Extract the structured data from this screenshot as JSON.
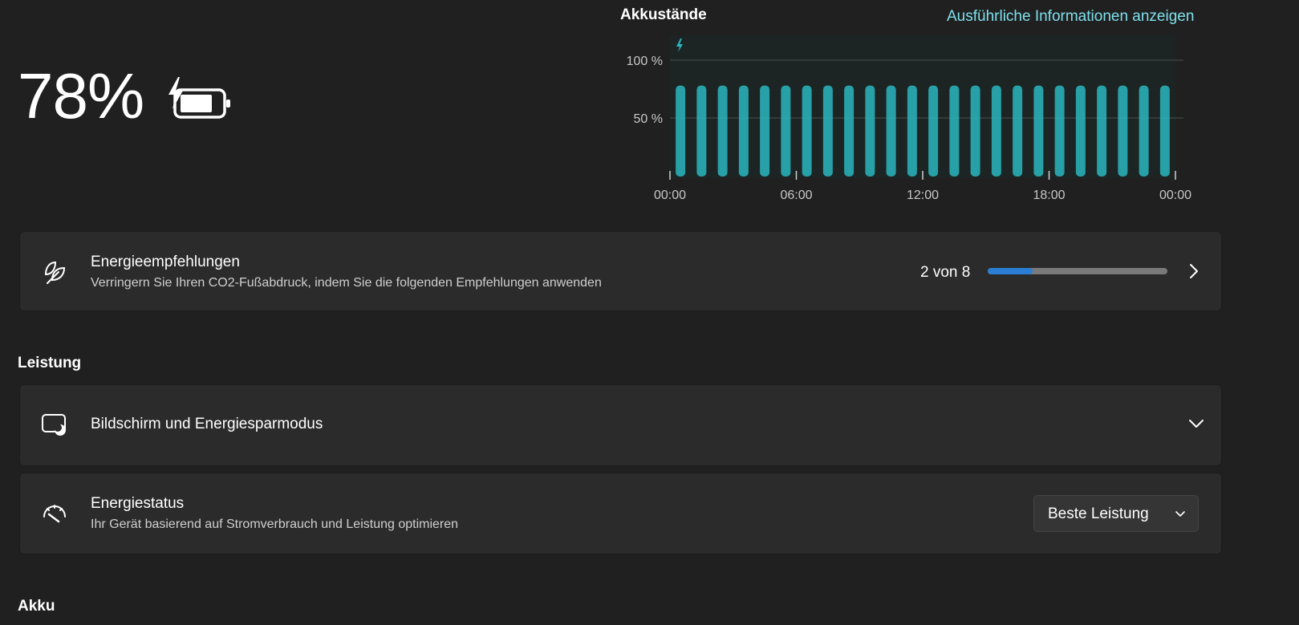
{
  "battery": {
    "percent_label": "78%",
    "percent": 78,
    "charging": true
  },
  "chart": {
    "title": "Akkustände",
    "details_link": "Ausführliche Informationen anzeigen"
  },
  "chart_data": {
    "type": "bar",
    "title": "Akkustände",
    "categories": [
      "00:00",
      "01:00",
      "02:00",
      "03:00",
      "04:00",
      "05:00",
      "06:00",
      "07:00",
      "08:00",
      "09:00",
      "10:00",
      "11:00",
      "12:00",
      "13:00",
      "14:00",
      "15:00",
      "16:00",
      "17:00",
      "18:00",
      "19:00",
      "20:00",
      "21:00",
      "22:00",
      "23:00"
    ],
    "values": [
      78,
      78,
      78,
      78,
      78,
      78,
      78,
      78,
      78,
      78,
      78,
      78,
      78,
      78,
      78,
      78,
      78,
      78,
      78,
      78,
      78,
      78,
      78,
      78
    ],
    "ylim": [
      0,
      100
    ],
    "y_ticks": [
      "100 %",
      "50 %"
    ],
    "y_tick_values": [
      100,
      50
    ],
    "x_tick_labels": [
      "00:00",
      "06:00",
      "12:00",
      "18:00",
      "00:00"
    ],
    "grid": true,
    "charging_indicator": true,
    "color": "#2ab6be"
  },
  "recommendations": {
    "title": "Energieempfehlungen",
    "subtitle": "Verringern Sie Ihren CO2-Fußabdruck, indem Sie die folgenden Empfehlungen anwenden",
    "count_label": "2 von 8",
    "done": 2,
    "total": 8
  },
  "performance": {
    "heading": "Leistung",
    "screen": {
      "title": "Bildschirm und Energiesparmodus"
    },
    "power_mode": {
      "title": "Energiestatus",
      "subtitle": "Ihr Gerät basierend auf Stromverbrauch und Leistung optimieren",
      "selected": "Beste Leistung"
    }
  },
  "akku": {
    "heading": "Akku"
  },
  "colors": {
    "background": "#202020",
    "card": "#2b2b2b",
    "accent": "#2a7fd4",
    "link": "#7ee0ec",
    "bar": "#2ab6be"
  },
  "icons": {
    "battery": "battery-charging-icon",
    "leaf": "leaf-icon",
    "screen": "screen-sleep-icon",
    "gauge": "gauge-icon",
    "chevron_right": "chevron-right-icon",
    "chevron_down": "chevron-down-icon"
  }
}
